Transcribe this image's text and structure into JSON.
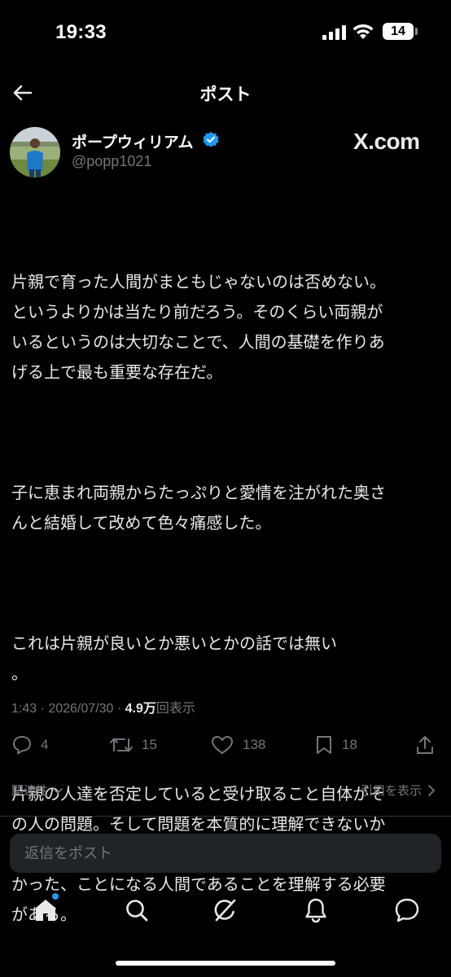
{
  "status_bar": {
    "time": "19:33",
    "battery": "14"
  },
  "header": {
    "title": "ポスト"
  },
  "author": {
    "name": "ポープウィリアム",
    "handle": "@popp1021",
    "badge": "X.com"
  },
  "post": {
    "paragraphs": [
      "片親で育った人間がまともじゃないのは否めない。\nというよりかは当たり前だろう。そのくらい両親が\nいるというのは大切なことで、人間の基礎を作りあ\nげる上で最も重要な存在だ。",
      "子に恵まれ両親からたっぷりと愛情を注がれた奥さ\nんと結婚して改めて色々痛感した。",
      "これは片親が良いとか悪いとかの話では無い\n。",
      "片親の人達を否定していると受け取ること自体がそ\nの人の問題。そして問題を本質的に理解できないか\nら結果として離婚をする、している、せざるを得な\nかった、ことになる人間であることを理解する必要\nがある。"
    ]
  },
  "meta": {
    "time": "1:43",
    "separator": " · ",
    "date": "2026/07/30",
    "views_count": "4.9万",
    "views_label": "回表示"
  },
  "actions": {
    "replies": "4",
    "reposts": "15",
    "likes": "138",
    "bookmarks": "18"
  },
  "related": {
    "label": "関連性",
    "quotes_label": "引用を表示"
  },
  "reply": {
    "placeholder": "返信をポスト"
  },
  "colors": {
    "accent": "#1d9bf0",
    "background": "#000000",
    "muted": "#71767b"
  }
}
